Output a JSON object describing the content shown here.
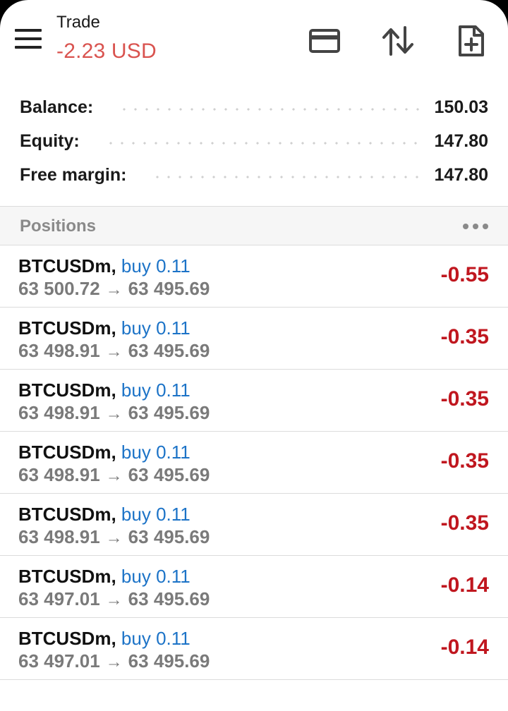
{
  "header": {
    "title": "Trade",
    "pl_value": "-2.23 USD",
    "icons": [
      "menu-icon",
      "credit-card-icon",
      "sort-arrows-icon",
      "new-order-icon"
    ]
  },
  "summary": [
    {
      "label": "Balance:",
      "value": "150.03"
    },
    {
      "label": "Equity:",
      "value": "147.80"
    },
    {
      "label": "Free margin:",
      "value": "147.80"
    }
  ],
  "section": {
    "title": "Positions",
    "more_icon": "more-dots-icon"
  },
  "positions": [
    {
      "symbol": "BTCUSDm",
      "direction": "buy",
      "volume": "0.11",
      "open_price": "63 500.72",
      "current_price": "63 495.69",
      "profit": "-0.55"
    },
    {
      "symbol": "BTCUSDm",
      "direction": "buy",
      "volume": "0.11",
      "open_price": "63 498.91",
      "current_price": "63 495.69",
      "profit": "-0.35"
    },
    {
      "symbol": "BTCUSDm",
      "direction": "buy",
      "volume": "0.11",
      "open_price": "63 498.91",
      "current_price": "63 495.69",
      "profit": "-0.35"
    },
    {
      "symbol": "BTCUSDm",
      "direction": "buy",
      "volume": "0.11",
      "open_price": "63 498.91",
      "current_price": "63 495.69",
      "profit": "-0.35"
    },
    {
      "symbol": "BTCUSDm",
      "direction": "buy",
      "volume": "0.11",
      "open_price": "63 498.91",
      "current_price": "63 495.69",
      "profit": "-0.35"
    },
    {
      "symbol": "BTCUSDm",
      "direction": "buy",
      "volume": "0.11",
      "open_price": "63 497.01",
      "current_price": "63 495.69",
      "profit": "-0.14"
    },
    {
      "symbol": "BTCUSDm",
      "direction": "buy",
      "volume": "0.11",
      "open_price": "63 497.01",
      "current_price": "63 495.69",
      "profit": "-0.14"
    }
  ],
  "colors": {
    "loss": "#c0171f",
    "header_loss": "#d9534f",
    "buy": "#1c73c7",
    "muted": "#7a7a7a"
  }
}
